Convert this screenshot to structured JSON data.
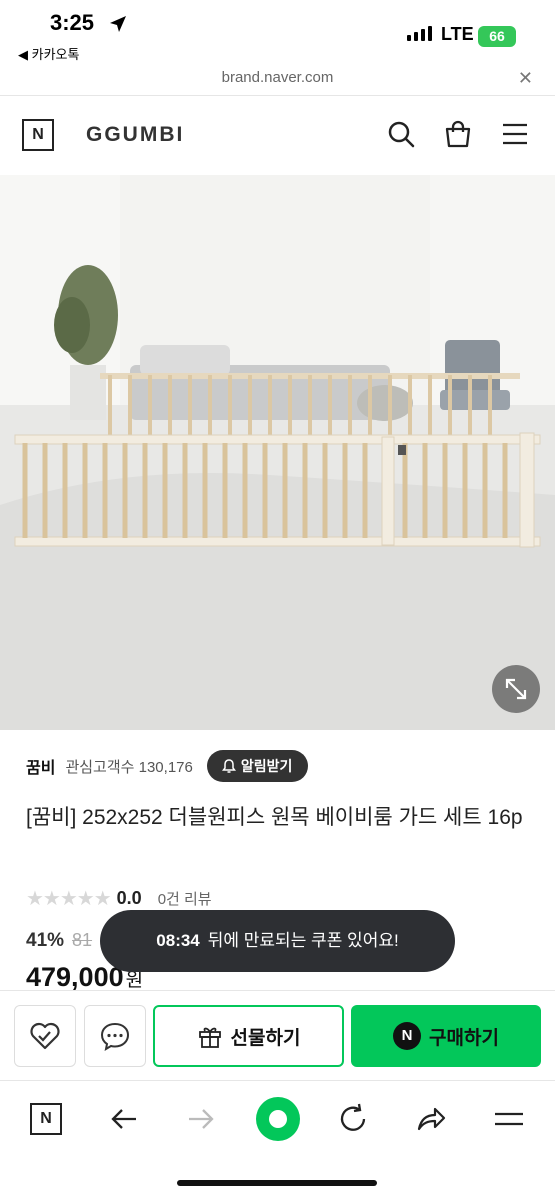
{
  "status_bar": {
    "time": "3:25",
    "back_app": "◀ 카카오톡",
    "network": "LTE",
    "battery": "66"
  },
  "url_bar": {
    "url": "brand.naver.com",
    "close_icon": "close-icon"
  },
  "header": {
    "logo": "N",
    "brand": "GGUMBI",
    "icons": [
      "search-icon",
      "shopping-bag-icon",
      "menu-icon"
    ]
  },
  "product": {
    "brand": "꿈비",
    "followers": "관심고객수 130,176",
    "alarm_button": "알림받기",
    "title": "[꿈비] 252x252 더블원피스 원목 베이비룸 가드 세트 16p",
    "stars": "★★★★★",
    "rating": "0.0",
    "reviews": "0건 리뷰",
    "discount": "41%",
    "original_price": "81",
    "price": "479,000",
    "currency": "원"
  },
  "toast": {
    "countdown": "08:34",
    "message": "뒤에 만료되는 쿠폰 있어요!"
  },
  "actions": {
    "gift": "선물하기",
    "buy": "구매하기",
    "buy_badge": "N"
  },
  "toolbar": {
    "logo": "N",
    "icons": [
      "naver-home-icon",
      "back-arrow-icon",
      "forward-arrow-icon",
      "green-dot-icon",
      "refresh-icon",
      "share-icon",
      "menu-icon"
    ]
  },
  "colors": {
    "naver_green": "#03c75a",
    "dark_chip": "#333333",
    "toast_bg": "#2d2f33"
  }
}
